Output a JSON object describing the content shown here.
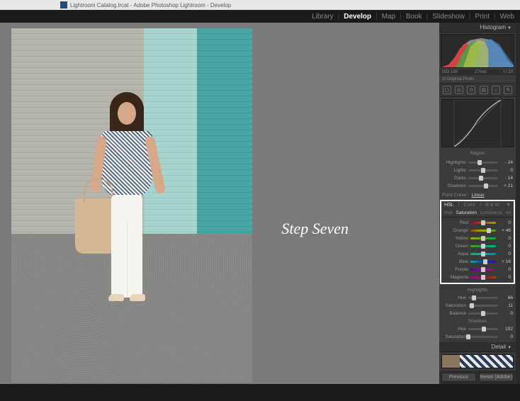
{
  "titlebar": {
    "text": "Lightroom Catalog.lrcat - Adobe Photoshop Lightroom - Develop"
  },
  "modules": {
    "library": "Library",
    "develop": "Develop",
    "map": "Map",
    "book": "Book",
    "slideshow": "Slideshow",
    "print": "Print",
    "web": "Web"
  },
  "annotation": "Step Seven",
  "histogram": {
    "title": "Histogram",
    "iso": "ISO 100",
    "lens": "27mm",
    "f": "f / 10",
    "orig": "Original Photo"
  },
  "tonecurve": {
    "region": "Region",
    "rows": [
      {
        "label": "Highlights",
        "value": "- 24",
        "pos": 38
      },
      {
        "label": "Lights",
        "value": "0",
        "pos": 50
      },
      {
        "label": "Darks",
        "value": "- 14",
        "pos": 43
      },
      {
        "label": "Shadows",
        "value": "+ 21",
        "pos": 60
      }
    ],
    "pointcurve": "Point Curve :",
    "linear": "Linear"
  },
  "hsl": {
    "title_hsl": "HSL",
    "title_color": "Color",
    "title_bw": "B & W",
    "tab_hue": "Hue",
    "tab_sat": "Saturation",
    "tab_lum": "Luminance",
    "tab_all": "All",
    "rows": [
      {
        "label": "Red",
        "value": "0",
        "pos": 50,
        "cls": "hue-r"
      },
      {
        "label": "Orange",
        "value": "+ 46",
        "pos": 73,
        "cls": "hue-o"
      },
      {
        "label": "Yellow",
        "value": "0",
        "pos": 50,
        "cls": "hue-y"
      },
      {
        "label": "Green",
        "value": "0",
        "pos": 50,
        "cls": "hue-g"
      },
      {
        "label": "Aqua",
        "value": "0",
        "pos": 50,
        "cls": "hue-a"
      },
      {
        "label": "Blue",
        "value": "+ 16",
        "pos": 58,
        "cls": "hue-b"
      },
      {
        "label": "Purple",
        "value": "0",
        "pos": 50,
        "cls": "hue-p"
      },
      {
        "label": "Magenta",
        "value": "0",
        "pos": 50,
        "cls": "hue-m"
      }
    ]
  },
  "splittone": {
    "highlights": "Highlights",
    "h_rows": [
      {
        "label": "Hue",
        "value": "66",
        "pos": 18
      },
      {
        "label": "Saturation",
        "value": "11",
        "pos": 11
      }
    ],
    "balance": {
      "label": "Balance",
      "value": "0",
      "pos": 50
    },
    "shadows": "Shadows",
    "s_rows": [
      {
        "label": "Hue",
        "value": "192",
        "pos": 53
      },
      {
        "label": "Saturation",
        "value": "0",
        "pos": 0
      }
    ]
  },
  "detail": {
    "title": "Detail"
  },
  "buttons": {
    "prev": "Previous",
    "reset": "Reset (Adobe)"
  }
}
